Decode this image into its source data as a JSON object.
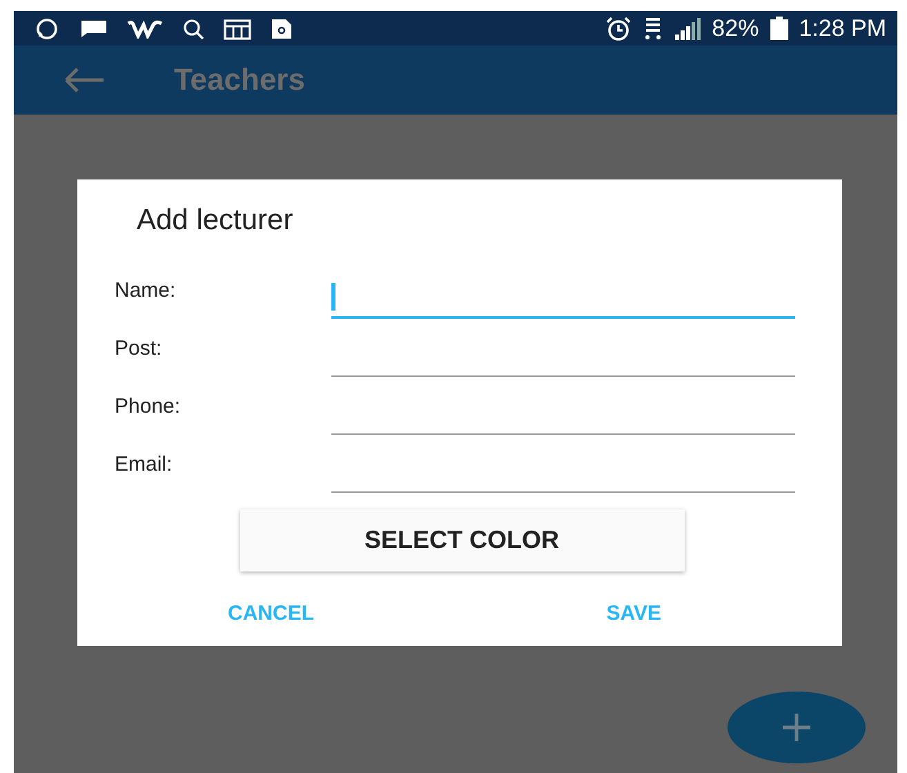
{
  "status_bar": {
    "battery": "82%",
    "time": "1:28 PM"
  },
  "app_bar": {
    "title": "Teachers"
  },
  "dialog": {
    "title": "Add lecturer",
    "fields": [
      {
        "label": "Name:",
        "focused": true
      },
      {
        "label": "Post:",
        "focused": false
      },
      {
        "label": "Phone:",
        "focused": false
      },
      {
        "label": "Email:",
        "focused": false
      }
    ],
    "color_button": "SELECT COLOR",
    "actions": [
      "CANCEL",
      "SAVE"
    ]
  }
}
